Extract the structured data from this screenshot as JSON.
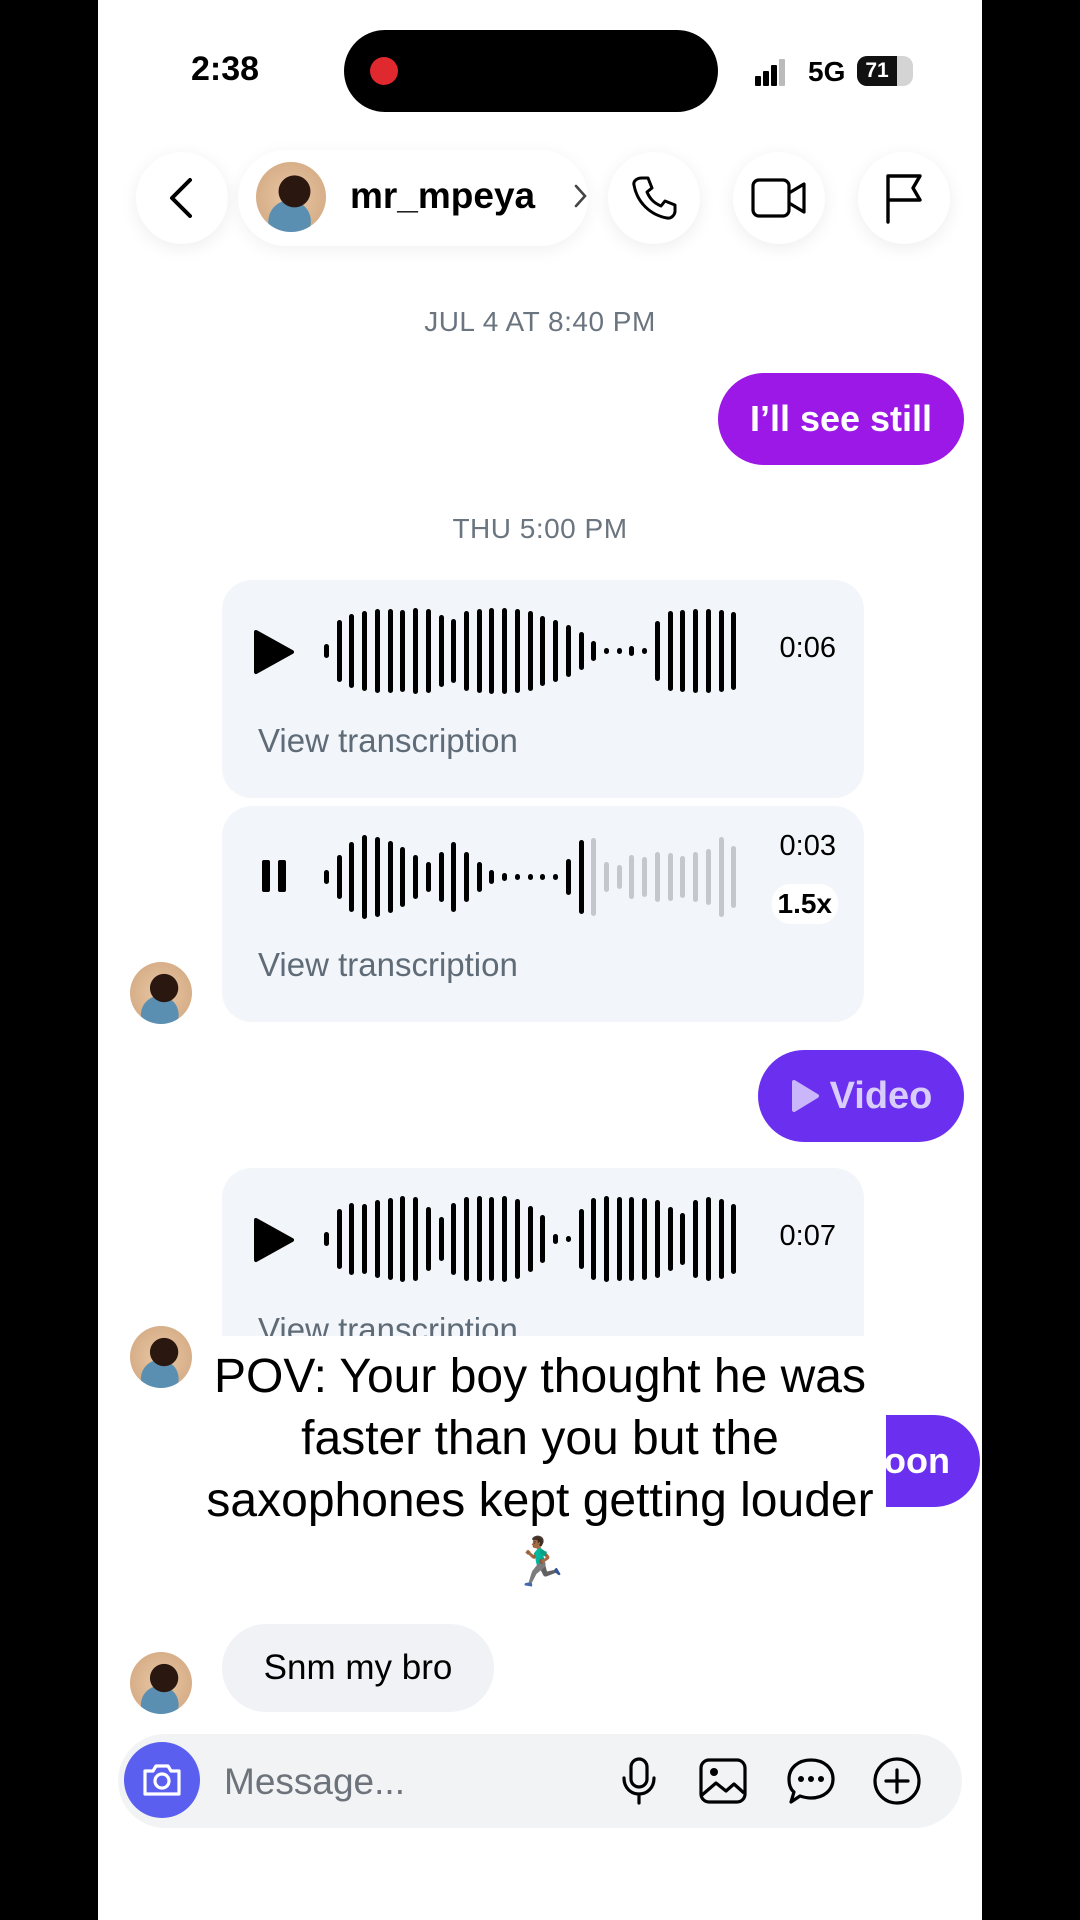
{
  "status_bar": {
    "time": "2:38",
    "network": "5G",
    "battery": "71"
  },
  "header": {
    "username": "mr_mpeya"
  },
  "messages": {
    "ts1": "JUL 4 AT 8:40 PM",
    "outgoing1": "I’ll see still",
    "ts2": "THU 5:00 PM",
    "voice1": {
      "duration": "0:06",
      "transcript": "View transcription"
    },
    "voice2": {
      "duration": "0:03",
      "speed": "1.5x",
      "transcript": "View transcription"
    },
    "video_label": "Video",
    "voice3": {
      "duration": "0:07",
      "transcript": "View transcription"
    },
    "partial_outgoing": "oon",
    "incoming_text": "Snm my bro"
  },
  "caption": "POV: Your boy thought he was faster than you but the saxophones kept getting louder 🏃🏾‍♂️",
  "composer": {
    "placeholder": "Message..."
  },
  "colors": {
    "outgoing": "#9b18e6",
    "video": "#6b2ff0",
    "camera": "#5b5ff0"
  }
}
